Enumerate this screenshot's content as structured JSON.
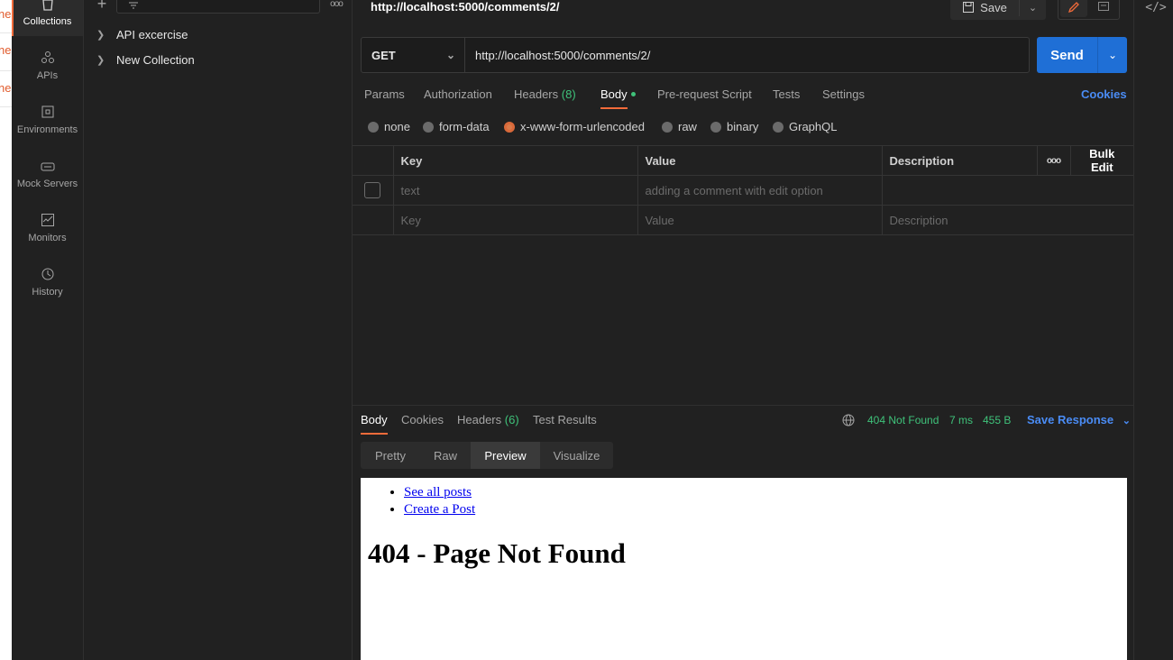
{
  "left_strip": {
    "fragments": [
      "ne",
      "ne",
      "ne"
    ]
  },
  "sidebar": {
    "items": [
      {
        "label": "Collections",
        "icon": "trash-can-icon",
        "active": true
      },
      {
        "label": "APIs",
        "icon": "apis-icon",
        "active": false
      },
      {
        "label": "Environments",
        "icon": "environments-icon",
        "active": false
      },
      {
        "label": "Mock Servers",
        "icon": "mock-server-icon",
        "active": false
      },
      {
        "label": "Monitors",
        "icon": "monitor-icon",
        "active": false
      },
      {
        "label": "History",
        "icon": "history-icon",
        "active": false
      }
    ]
  },
  "collections": {
    "items": [
      {
        "label": "API excercise"
      },
      {
        "label": "New Collection"
      }
    ]
  },
  "request": {
    "title": "http://localhost:5000/comments/2/",
    "save_label": "Save",
    "method": "GET",
    "url": "http://localhost:5000/comments/2/",
    "send_label": "Send",
    "tabs": {
      "params": "Params",
      "authorization": "Authorization",
      "headers": "Headers",
      "headers_count": "(8)",
      "body": "Body",
      "prerequest": "Pre-request Script",
      "tests": "Tests",
      "settings": "Settings"
    },
    "cookies_label": "Cookies",
    "body_types": {
      "none": "none",
      "form_data": "form-data",
      "urlencoded": "x-www-form-urlencoded",
      "raw": "raw",
      "binary": "binary",
      "graphql": "GraphQL"
    },
    "selected_body_type": "x-www-form-urlencoded",
    "table": {
      "headers": {
        "key": "Key",
        "value": "Value",
        "description": "Description",
        "bulk_edit": "Bulk Edit",
        "more": "ooo"
      },
      "row": {
        "key": "text",
        "value": "adding a comment with edit option",
        "description": ""
      },
      "placeholder": {
        "key": "Key",
        "value": "Value",
        "description": "Description"
      }
    }
  },
  "response": {
    "tabs": {
      "body": "Body",
      "cookies": "Cookies",
      "headers": "Headers",
      "headers_count": "(6)",
      "test_results": "Test Results"
    },
    "status": "404 Not Found",
    "time": "7 ms",
    "size": "455 B",
    "save_response": "Save Response",
    "view_tabs": {
      "pretty": "Pretty",
      "raw": "Raw",
      "preview": "Preview",
      "visualize": "Visualize"
    },
    "selected_view": "Preview",
    "preview": {
      "links": [
        "See all posts",
        "Create a Post"
      ],
      "heading": "404 - Page Not Found"
    }
  },
  "colors": {
    "accent": "#f26b3a",
    "send": "#1f6fd6",
    "status_ok": "#3fc27a",
    "link_blue": "#4a8cf5"
  }
}
